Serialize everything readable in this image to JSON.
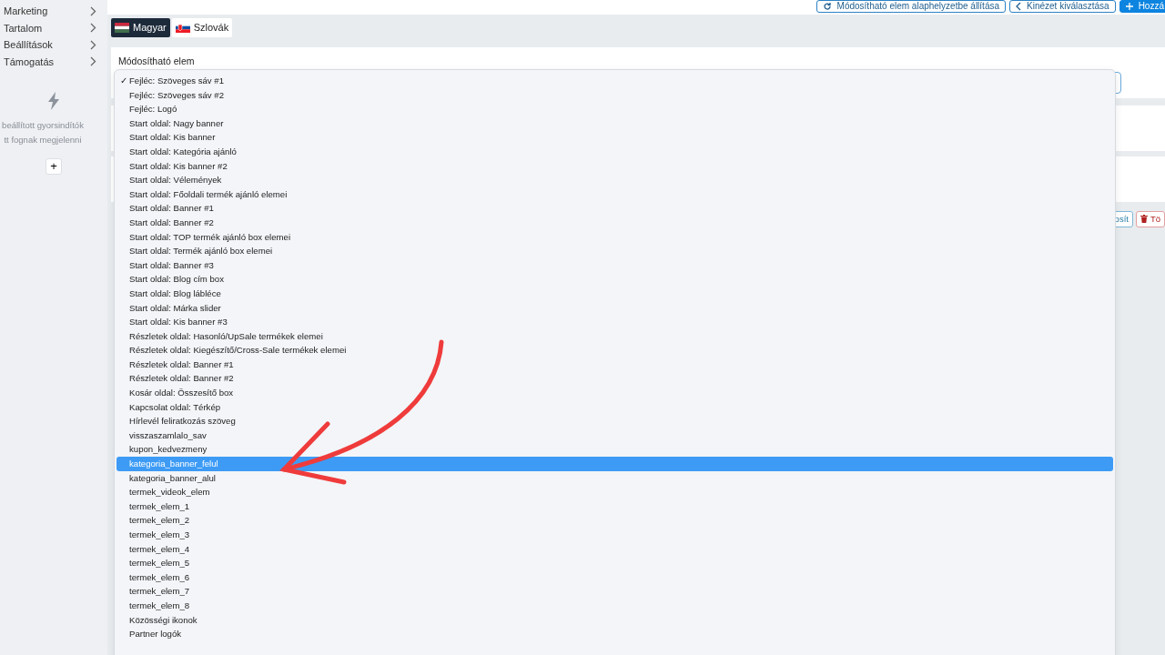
{
  "sidebar": {
    "items": [
      {
        "label": "Marketing"
      },
      {
        "label": "Tartalom"
      },
      {
        "label": "Beállítások"
      },
      {
        "label": "Támogatás"
      }
    ],
    "quick_launch": {
      "message_lines": [
        "beállított gyorsindítók",
        "tt fognak megjelenni"
      ],
      "add_button": "+"
    }
  },
  "toolbar": {
    "buttons": [
      {
        "label": "Módosítható elem alaphelyzetbe állítása",
        "kind": "reset"
      },
      {
        "label": "Kinézet kiválasztása",
        "kind": "back"
      },
      {
        "label": "Hozzá",
        "kind": "add"
      }
    ]
  },
  "language_tabs": [
    {
      "label": "Magyar",
      "kind": "hu",
      "selected": true
    },
    {
      "label": "Szlovák",
      "kind": "sk",
      "selected": false
    }
  ],
  "field": {
    "label": "Módosítható elem"
  },
  "row_buttons": [
    {
      "label": "osít",
      "kind": "edit"
    },
    {
      "label": "Tö",
      "kind": "delete"
    }
  ],
  "dropdown": {
    "check_mark": "✓",
    "options": [
      {
        "label": "Fejléc: Szöveges sáv #1",
        "checked": true,
        "selected": false
      },
      {
        "label": "Fejléc: Szöveges sáv #2",
        "checked": false,
        "selected": false
      },
      {
        "label": "Fejléc: Logó",
        "checked": false,
        "selected": false
      },
      {
        "label": "Start oldal: Nagy banner",
        "checked": false,
        "selected": false
      },
      {
        "label": "Start oldal: Kis banner",
        "checked": false,
        "selected": false
      },
      {
        "label": "Start oldal: Kategória ajánló",
        "checked": false,
        "selected": false
      },
      {
        "label": "Start oldal: Kis banner #2",
        "checked": false,
        "selected": false
      },
      {
        "label": "Start oldal: Vélemények",
        "checked": false,
        "selected": false
      },
      {
        "label": "Start oldal: Főoldali termék ajánló elemei",
        "checked": false,
        "selected": false
      },
      {
        "label": "Start oldal: Banner #1",
        "checked": false,
        "selected": false
      },
      {
        "label": "Start oldal: Banner #2",
        "checked": false,
        "selected": false
      },
      {
        "label": "Start oldal: TOP termék ajánló box elemei",
        "checked": false,
        "selected": false
      },
      {
        "label": "Start oldal: Termék ajánló box elemei",
        "checked": false,
        "selected": false
      },
      {
        "label": "Start oldal: Banner #3",
        "checked": false,
        "selected": false
      },
      {
        "label": "Start oldal: Blog cím box",
        "checked": false,
        "selected": false
      },
      {
        "label": "Start oldal: Blog lábléce",
        "checked": false,
        "selected": false
      },
      {
        "label": "Start oldal: Márka slider",
        "checked": false,
        "selected": false
      },
      {
        "label": "Start oldal: Kis banner #3",
        "checked": false,
        "selected": false
      },
      {
        "label": "Részletek oldal: Hasonló/UpSale termékek elemei",
        "checked": false,
        "selected": false
      },
      {
        "label": "Részletek oldal: Kiegészítő/Cross-Sale termékek elemei",
        "checked": false,
        "selected": false
      },
      {
        "label": "Részletek oldal: Banner #1",
        "checked": false,
        "selected": false
      },
      {
        "label": "Részletek oldal: Banner #2",
        "checked": false,
        "selected": false
      },
      {
        "label": "Kosár oldal: Összesítő box",
        "checked": false,
        "selected": false
      },
      {
        "label": "Kapcsolat oldal: Térkép",
        "checked": false,
        "selected": false
      },
      {
        "label": "Hírlevél feliratkozás szöveg",
        "checked": false,
        "selected": false
      },
      {
        "label": "visszaszamlalo_sav",
        "checked": false,
        "selected": false
      },
      {
        "label": "kupon_kedvezmeny",
        "checked": false,
        "selected": false
      },
      {
        "label": "kategoria_banner_felul",
        "checked": false,
        "selected": true
      },
      {
        "label": "kategoria_banner_alul",
        "checked": false,
        "selected": false
      },
      {
        "label": "termek_videok_elem",
        "checked": false,
        "selected": false
      },
      {
        "label": "termek_elem_1",
        "checked": false,
        "selected": false
      },
      {
        "label": "termek_elem_2",
        "checked": false,
        "selected": false
      },
      {
        "label": "termek_elem_3",
        "checked": false,
        "selected": false
      },
      {
        "label": "termek_elem_4",
        "checked": false,
        "selected": false
      },
      {
        "label": "termek_elem_5",
        "checked": false,
        "selected": false
      },
      {
        "label": "termek_elem_6",
        "checked": false,
        "selected": false
      },
      {
        "label": "termek_elem_7",
        "checked": false,
        "selected": false
      },
      {
        "label": "termek_elem_8",
        "checked": false,
        "selected": false
      },
      {
        "label": "Közösségi ikonok",
        "checked": false,
        "selected": false
      },
      {
        "label": "Partner logók",
        "checked": false,
        "selected": false
      }
    ]
  }
}
